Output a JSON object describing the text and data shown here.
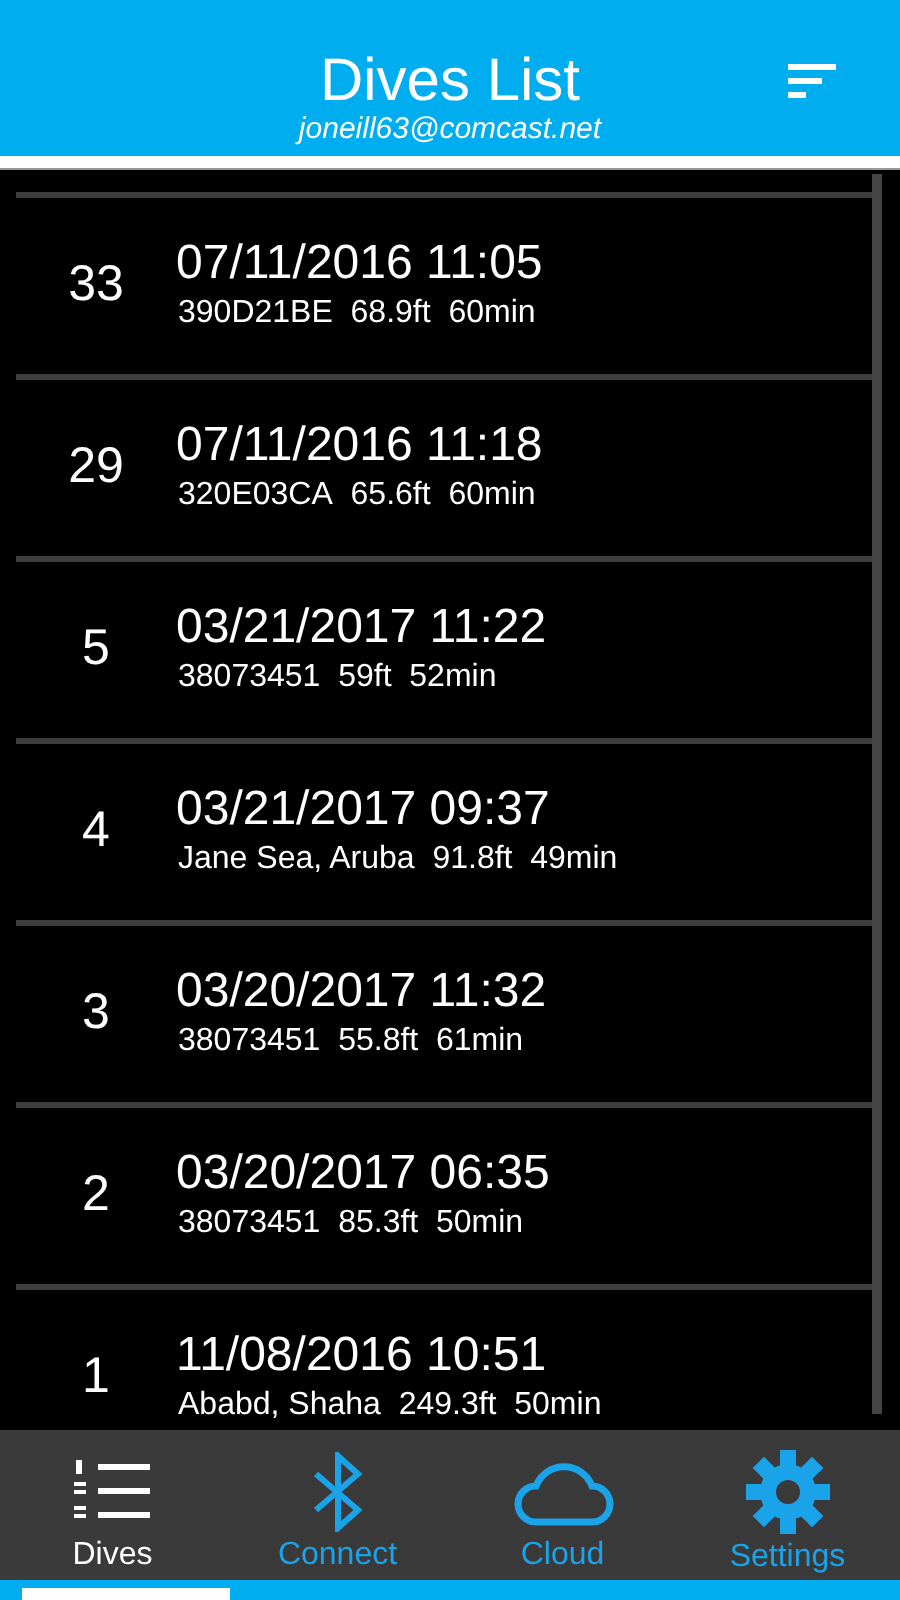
{
  "header": {
    "title": "Dives List",
    "account": "joneill63@comcast.net"
  },
  "dives": [
    {
      "number": "33",
      "datetime": "07/11/2016 11:05",
      "location": "390D21BE",
      "depth": "68.9ft",
      "duration": "60min"
    },
    {
      "number": "29",
      "datetime": "07/11/2016 11:18",
      "location": "320E03CA",
      "depth": "65.6ft",
      "duration": "60min"
    },
    {
      "number": "5",
      "datetime": "03/21/2017 11:22",
      "location": "38073451",
      "depth": "59ft",
      "duration": "52min"
    },
    {
      "number": "4",
      "datetime": "03/21/2017 09:37",
      "location": "Jane Sea, Aruba",
      "depth": "91.8ft",
      "duration": "49min"
    },
    {
      "number": "3",
      "datetime": "03/20/2017 11:32",
      "location": "38073451",
      "depth": "55.8ft",
      "duration": "61min"
    },
    {
      "number": "2",
      "datetime": "03/20/2017 06:35",
      "location": "38073451",
      "depth": "85.3ft",
      "duration": "50min"
    },
    {
      "number": "1",
      "datetime": "11/08/2016 10:51",
      "location": "Ababd, Shaha",
      "depth": "249.3ft",
      "duration": "50min"
    }
  ],
  "tabs": [
    {
      "kind": "list",
      "label": "Dives",
      "selected": true
    },
    {
      "kind": "bluetooth",
      "label": "Connect",
      "selected": false
    },
    {
      "kind": "cloud",
      "label": "Cloud",
      "selected": false
    },
    {
      "kind": "gear",
      "label": "Settings",
      "selected": false
    }
  ]
}
